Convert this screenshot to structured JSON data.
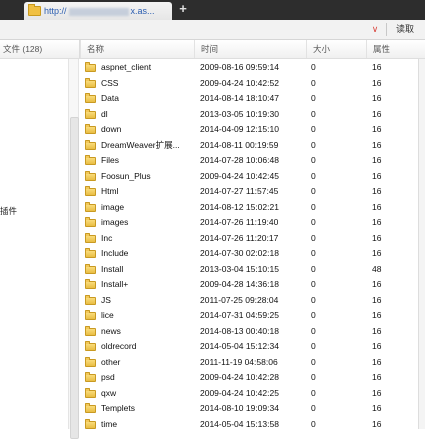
{
  "tab": {
    "url_prefix": "http://",
    "url_suffix": "x.as...",
    "add_symbol": "+"
  },
  "toolbar": {
    "dropdown_symbol": "∨",
    "read_label": "读取"
  },
  "left_header": "文件 (128)",
  "left_pane": {
    "plugin_label": "插件"
  },
  "columns": {
    "name": "名称",
    "time": "时间",
    "size": "大小",
    "attr": "属性"
  },
  "files": [
    {
      "name": "aspnet_client",
      "time": "2009-08-16 09:59:14",
      "size": "0",
      "attr": "16"
    },
    {
      "name": "CSS",
      "time": "2009-04-24 10:42:52",
      "size": "0",
      "attr": "16"
    },
    {
      "name": "Data",
      "time": "2014-08-14 18:10:47",
      "size": "0",
      "attr": "16"
    },
    {
      "name": "dl",
      "time": "2013-03-05 10:19:30",
      "size": "0",
      "attr": "16"
    },
    {
      "name": "down",
      "time": "2014-04-09 12:15:10",
      "size": "0",
      "attr": "16"
    },
    {
      "name": "DreamWeaver扩展...",
      "time": "2014-08-11 00:19:59",
      "size": "0",
      "attr": "16"
    },
    {
      "name": "Files",
      "time": "2014-07-28 10:06:48",
      "size": "0",
      "attr": "16"
    },
    {
      "name": "Foosun_Plus",
      "time": "2009-04-24 10:42:45",
      "size": "0",
      "attr": "16"
    },
    {
      "name": "Html",
      "time": "2014-07-27 11:57:45",
      "size": "0",
      "attr": "16"
    },
    {
      "name": "image",
      "time": "2014-08-12 15:02:21",
      "size": "0",
      "attr": "16"
    },
    {
      "name": "images",
      "time": "2014-07-26 11:19:40",
      "size": "0",
      "attr": "16"
    },
    {
      "name": "Inc",
      "time": "2014-07-26 11:20:17",
      "size": "0",
      "attr": "16"
    },
    {
      "name": "Include",
      "time": "2014-07-30 02:02:18",
      "size": "0",
      "attr": "16"
    },
    {
      "name": "Install",
      "time": "2013-03-04 15:10:15",
      "size": "0",
      "attr": "48"
    },
    {
      "name": "Install+",
      "time": "2009-04-28 14:36:18",
      "size": "0",
      "attr": "16"
    },
    {
      "name": "JS",
      "time": "2011-07-25 09:28:04",
      "size": "0",
      "attr": "16"
    },
    {
      "name": "lice",
      "time": "2014-07-31 04:59:25",
      "size": "0",
      "attr": "16"
    },
    {
      "name": "news",
      "time": "2014-08-13 00:40:18",
      "size": "0",
      "attr": "16"
    },
    {
      "name": "oldrecord",
      "time": "2014-05-04 15:12:34",
      "size": "0",
      "attr": "16"
    },
    {
      "name": "other",
      "time": "2011-11-19 04:58:06",
      "size": "0",
      "attr": "16"
    },
    {
      "name": "psd",
      "time": "2009-04-24 10:42:28",
      "size": "0",
      "attr": "16"
    },
    {
      "name": "qxw",
      "time": "2009-04-24 10:42:25",
      "size": "0",
      "attr": "16"
    },
    {
      "name": "Templets",
      "time": "2014-08-10 19:09:34",
      "size": "0",
      "attr": "16"
    },
    {
      "name": "time",
      "time": "2014-05-04 15:13:58",
      "size": "0",
      "attr": "16"
    }
  ]
}
